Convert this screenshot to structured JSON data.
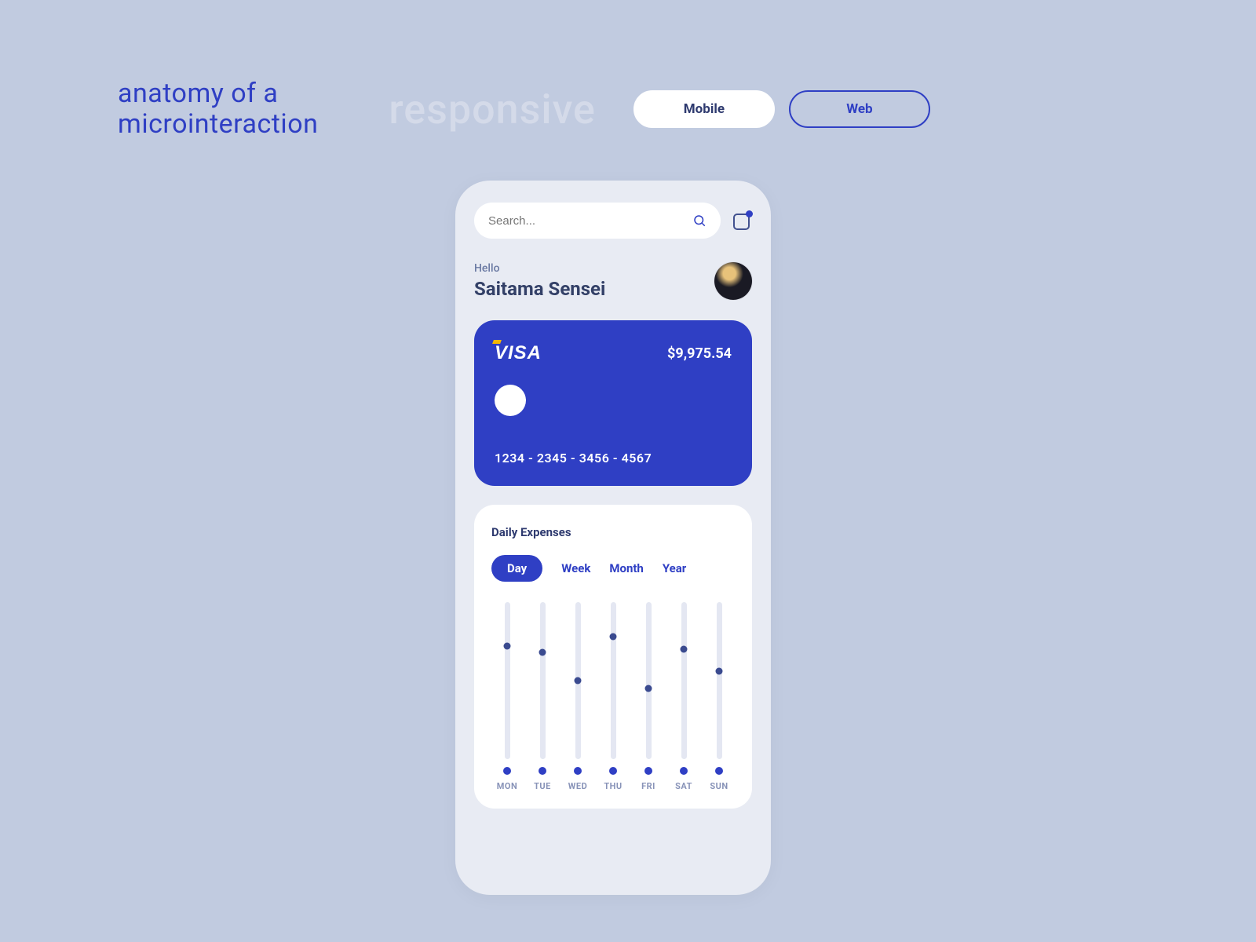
{
  "header": {
    "title_line1": "anatomy of a",
    "title_line2": "microinteraction",
    "subtitle": "responsive",
    "toggle": {
      "mobile": "Mobile",
      "web": "Web",
      "active": "mobile"
    }
  },
  "search": {
    "placeholder": "Search..."
  },
  "greeting": {
    "hello": "Hello",
    "name": "Saitama Sensei"
  },
  "card": {
    "brand": "VISA",
    "balance": "$9,975.54",
    "number": "1234 - 2345 - 3456 - 4567"
  },
  "expenses": {
    "title": "Daily Expenses",
    "ranges": [
      "Day",
      "Week",
      "Month",
      "Year"
    ],
    "active_range": "Day"
  },
  "chart_data": {
    "type": "bar",
    "title": "Daily Expenses",
    "categories": [
      "MON",
      "TUE",
      "WED",
      "THU",
      "FRI",
      "SAT",
      "SUN"
    ],
    "values": [
      72,
      68,
      50,
      78,
      45,
      70,
      56
    ],
    "ylim": [
      0,
      100
    ],
    "xlabel": "",
    "ylabel": ""
  }
}
